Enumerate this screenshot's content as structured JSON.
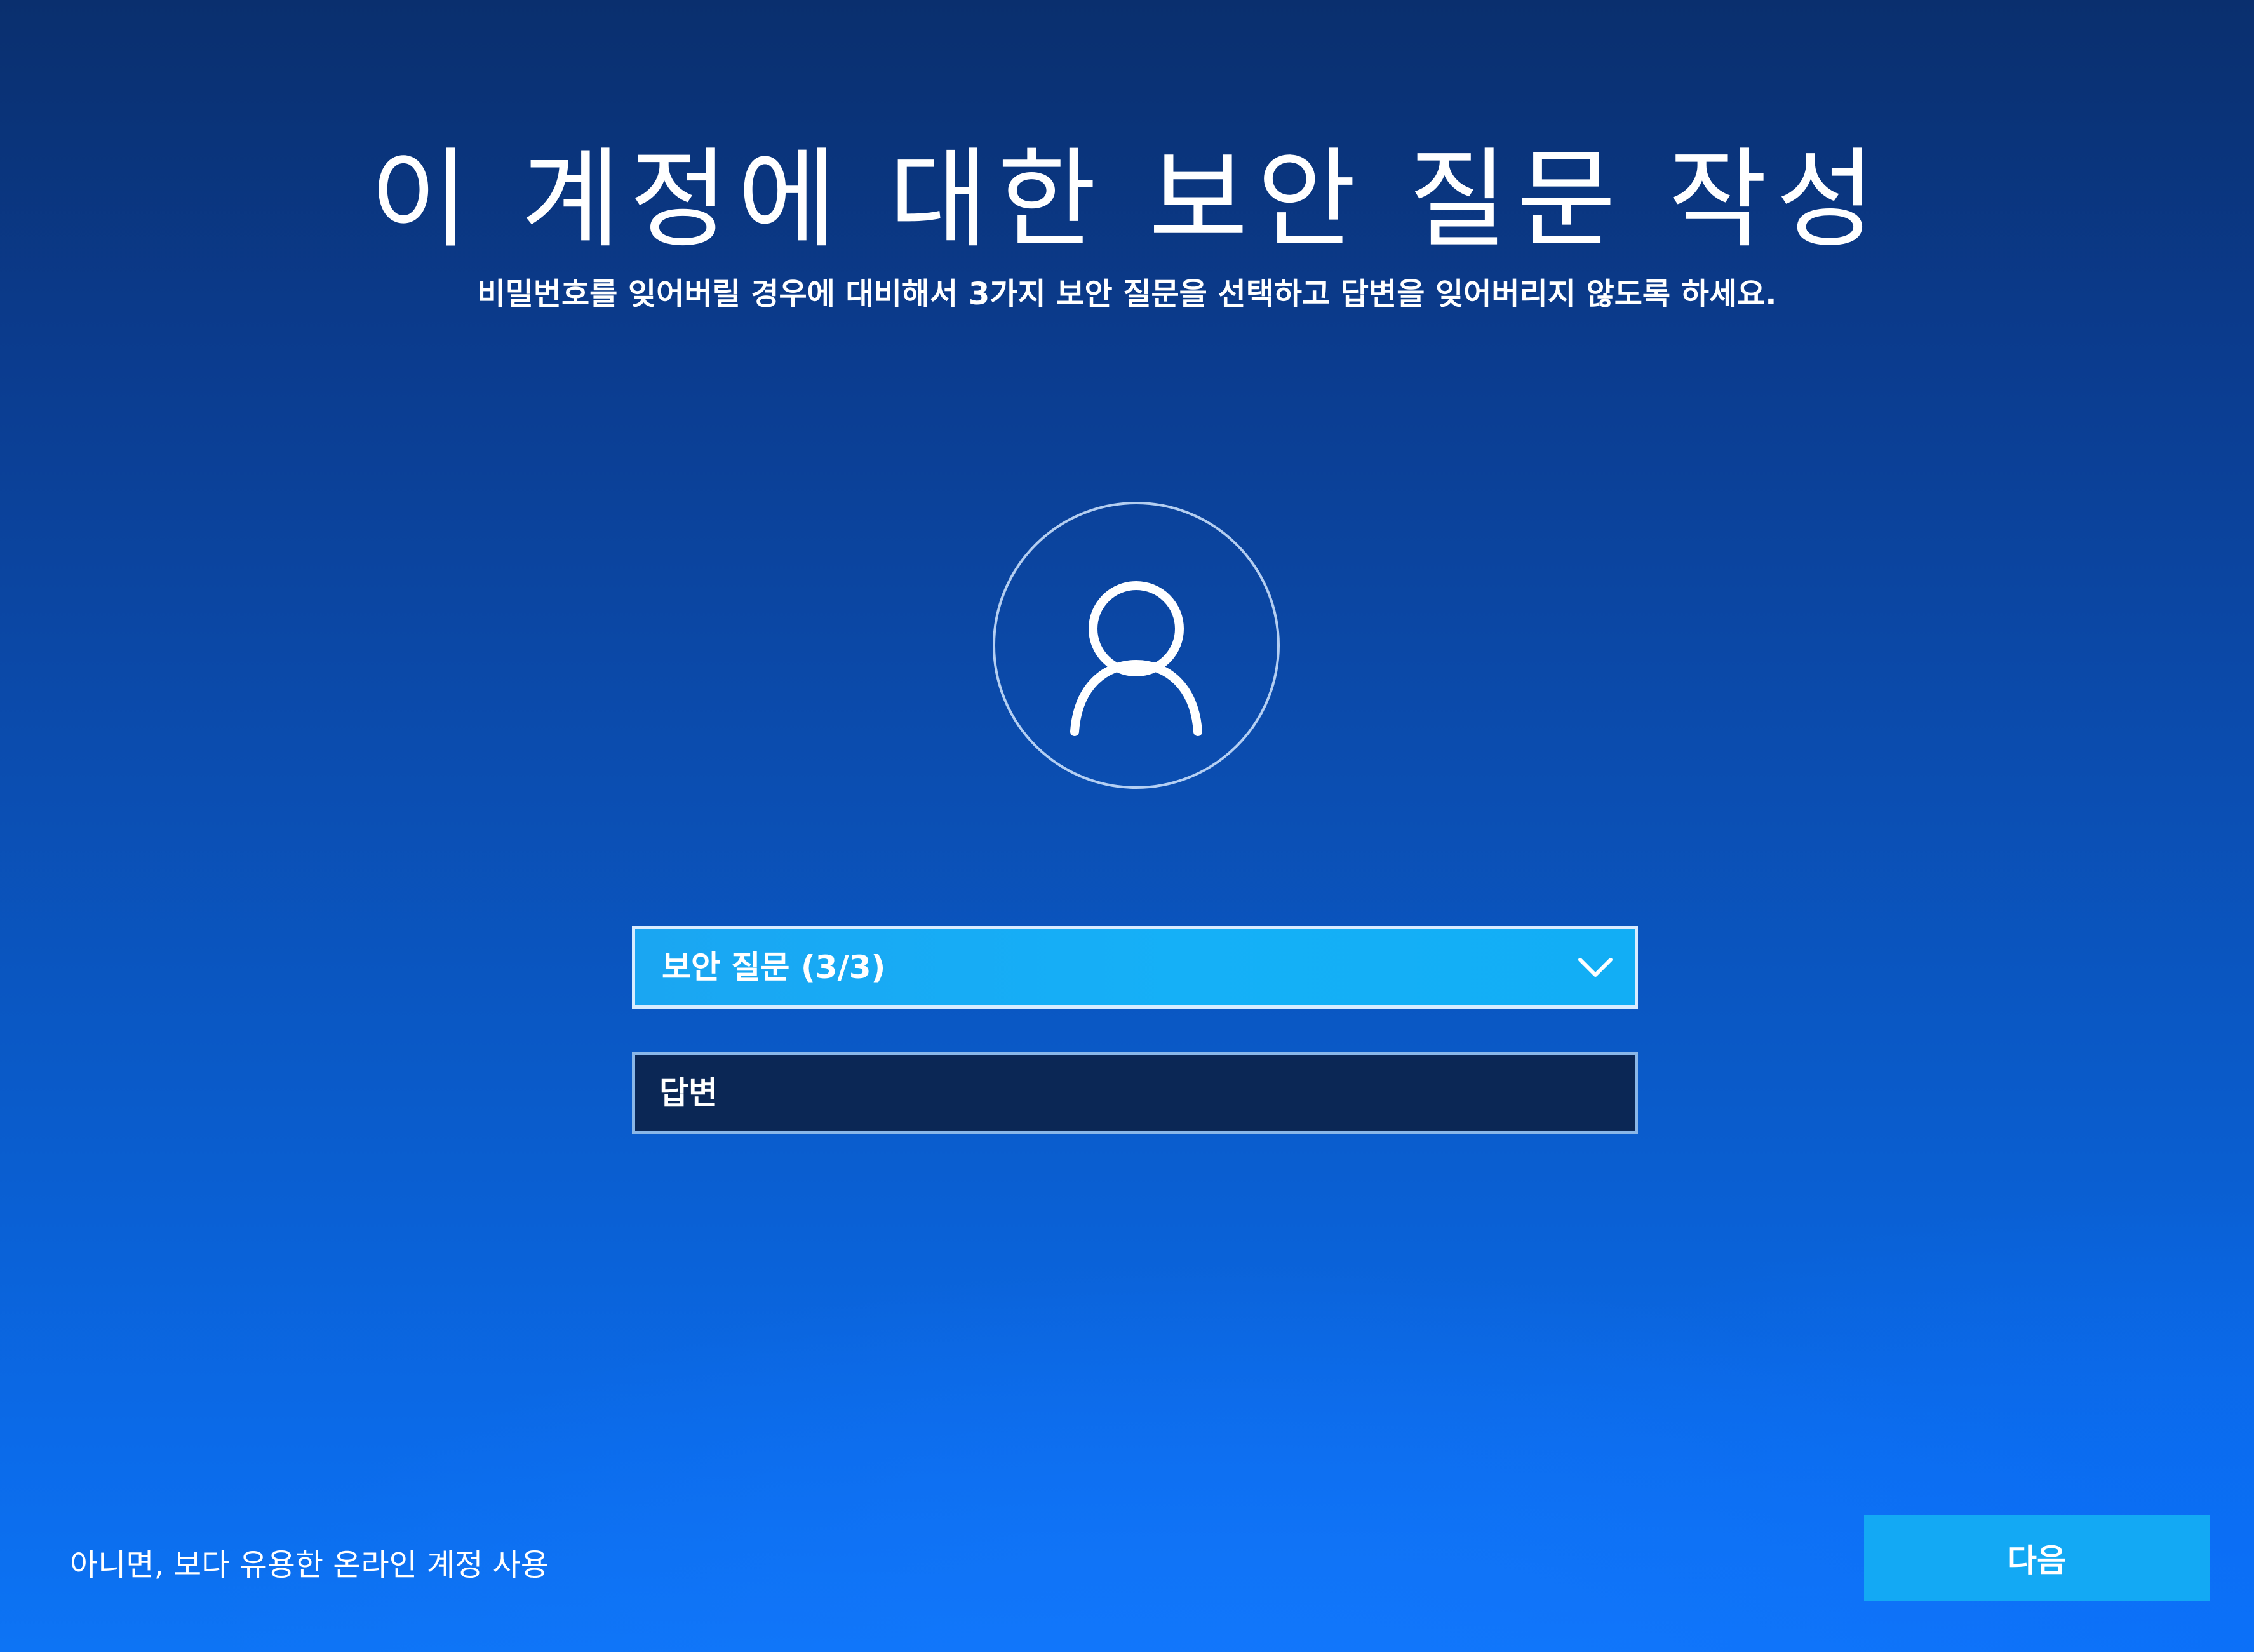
{
  "page": {
    "title": "이 계정에 대한 보안 질문 작성",
    "subtitle": "비밀번호를 잊어버릴 경우에 대비해서 3가지 보안 질문을 선택하고 답변을 잊어버리지 않도록 하세요."
  },
  "avatar": {
    "icon": "user-icon"
  },
  "form": {
    "question_select_label": "보안 질문 (3/3)",
    "answer_placeholder": "답변",
    "answer_value": ""
  },
  "footer": {
    "online_account_link": "아니면, 보다 유용한 온라인 계정 사용",
    "next_label": "다음"
  },
  "colors": {
    "background_top": "#0a2f6e",
    "background_bottom": "#0d74f5",
    "select_fill": "#15b0f7",
    "answer_fill": "#0b2755",
    "button_fill": "#13a9f4"
  }
}
